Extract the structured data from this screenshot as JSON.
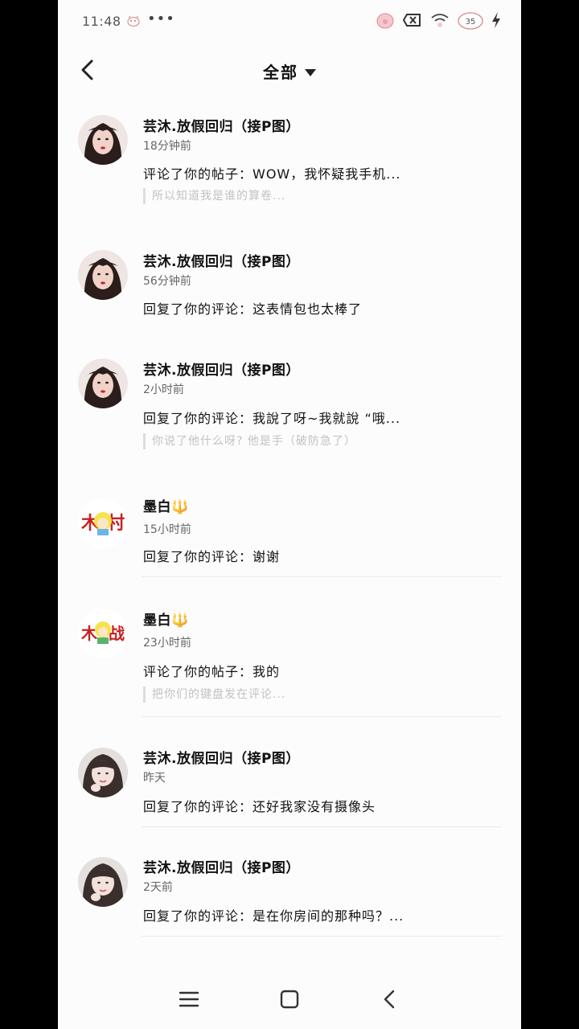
{
  "status_bar": {
    "time": "11:48",
    "dots": "•••",
    "battery_level": "35",
    "icons": [
      "pig-sticker-icon",
      "close-box-icon",
      "wifi-icon",
      "battery-icon",
      "charging-icon"
    ]
  },
  "header": {
    "title": "全部",
    "back_icon": "chevron-left-icon",
    "dropdown_icon": "caret-down-icon"
  },
  "notifications": [
    {
      "avatar": "avatar-girl-1",
      "username": "芸沐.放假回归（接P图）",
      "time": "18分钟前",
      "action": "评论了你的帖子：WOW，我怀疑我手机...",
      "quote": "所以知道我是谁的算卷..."
    },
    {
      "avatar": "avatar-girl-1",
      "username": "芸沐.放假回归（接P图）",
      "time": "56分钟前",
      "action": "回复了你的评论：这表情包也太棒了",
      "quote": ""
    },
    {
      "avatar": "avatar-girl-1",
      "username": "芸沐.放假回归（接P图）",
      "time": "2小时前",
      "action": "回复了你的评论：我說了呀~我就說 “哦...",
      "quote": "你说了他什么呀? 他是手（破防急了）"
    },
    {
      "avatar": "avatar-cartoon",
      "username": "墨白🔱",
      "time": "15小时前",
      "action": "回复了你的评论：谢谢",
      "quote": ""
    },
    {
      "avatar": "avatar-cartoon",
      "username": "墨白🔱",
      "time": "23小时前",
      "action": "评论了你的帖子：我的",
      "quote": "把你们的键盘发在评论..."
    },
    {
      "avatar": "avatar-girl-2",
      "username": "芸沐.放假回归（接P图）",
      "time": "昨天",
      "action": "回复了你的评论：还好我家没有摄像头",
      "quote": ""
    },
    {
      "avatar": "avatar-girl-2",
      "username": "芸沐.放假回归（接P图）",
      "time": "2天前",
      "action": "回复了你的评论：是在你房间的那种吗？...",
      "quote": ""
    }
  ],
  "navbar": {
    "items": [
      "menu-icon",
      "home-square-icon",
      "back-triangle-icon"
    ]
  }
}
